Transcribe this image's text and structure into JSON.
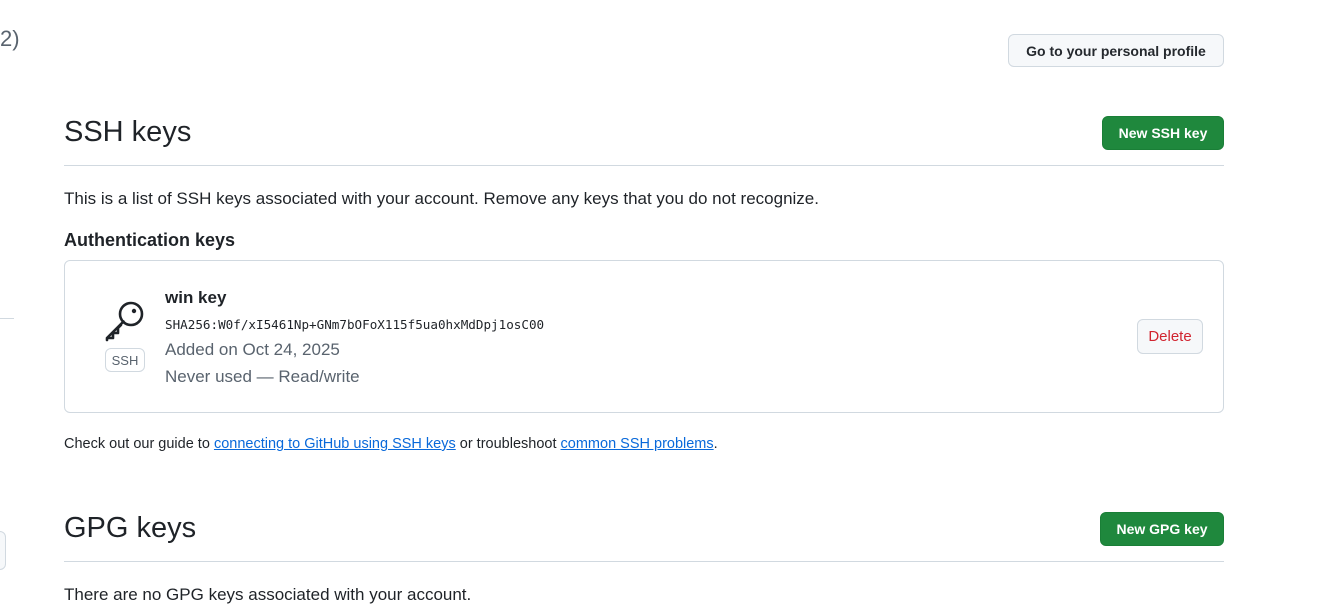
{
  "edge": {
    "fragment_text": "2)"
  },
  "header": {
    "profile_button_label": "Go to your personal profile"
  },
  "ssh_section": {
    "title": "SSH keys",
    "new_button_label": "New SSH key",
    "description": "This is a list of SSH keys associated with your account. Remove any keys that you do not recognize.",
    "auth_heading": "Authentication keys",
    "keys": [
      {
        "icon": "key-icon",
        "badge": "SSH",
        "name": "win key",
        "fingerprint": "SHA256:W0f/xI5461Np+GNm7bOFoX115f5ua0hxMdDpj1osC00",
        "added": "Added on Oct 24, 2025",
        "usage": "Never used — Read/write",
        "delete_label": "Delete"
      }
    ],
    "guide": {
      "prefix": "Check out our guide to ",
      "link1": "connecting to GitHub using SSH keys",
      "middle": " or troubleshoot ",
      "link2": "common SSH problems",
      "suffix": "."
    }
  },
  "gpg_section": {
    "title": "GPG keys",
    "new_button_label": "New GPG key",
    "empty_text": "There are no GPG keys associated with your account."
  },
  "colors": {
    "primary_green": "#1f883d",
    "danger_red": "#d1242f",
    "link_blue": "#0969da",
    "border": "#d1d9e0",
    "muted_text": "#59636e"
  }
}
